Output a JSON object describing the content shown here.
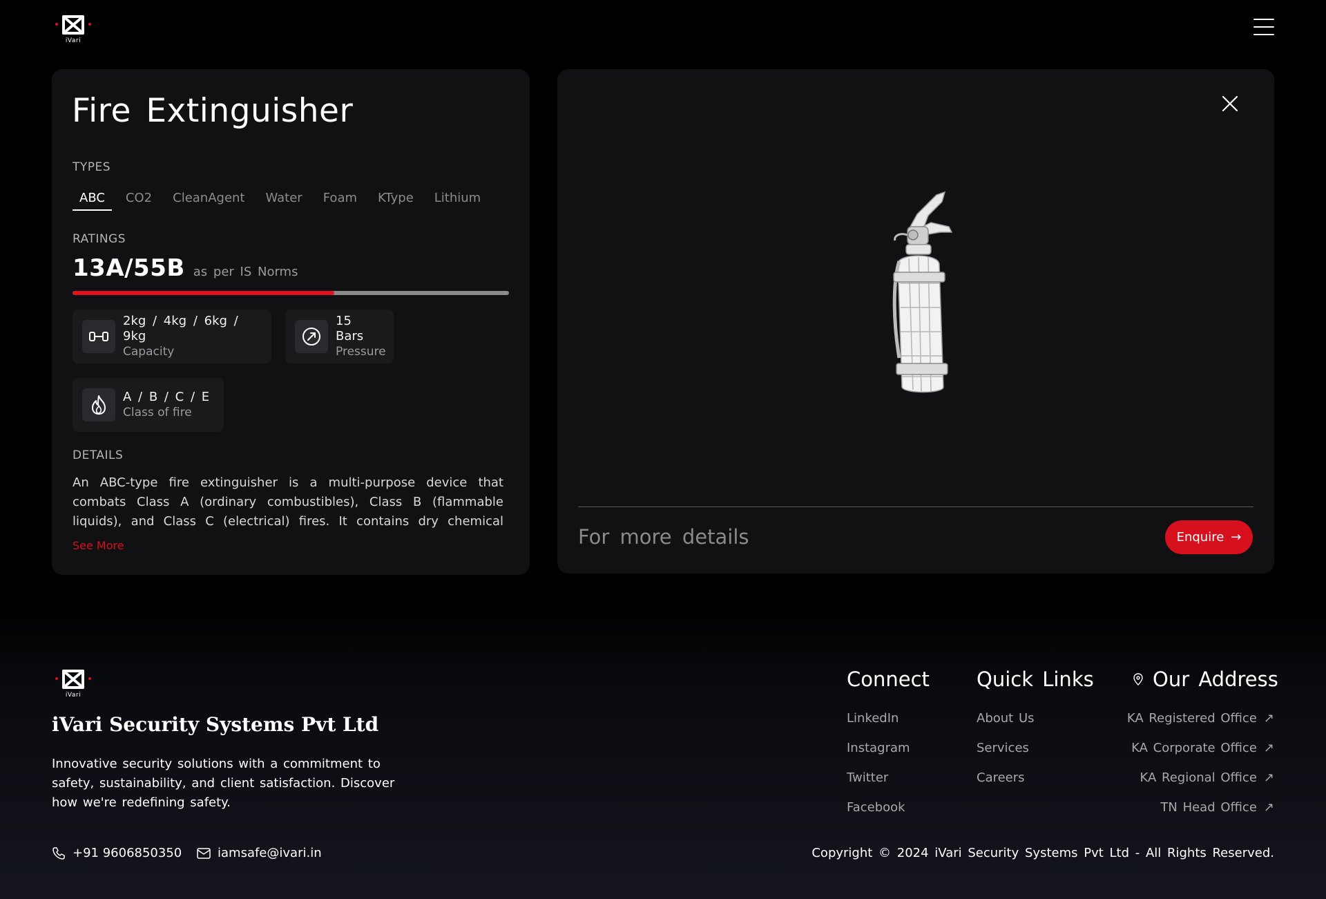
{
  "brand": {
    "logo_text": "iVari",
    "accent_color": "#d6101d"
  },
  "header": {
    "menu_icon": "hamburger-menu-icon"
  },
  "product": {
    "title": "Fire Extinguisher",
    "types_label": "TYPES",
    "types": [
      {
        "label": "ABC",
        "active": true
      },
      {
        "label": "CO2",
        "active": false
      },
      {
        "label": "CleanAgent",
        "active": false
      },
      {
        "label": "Water",
        "active": false
      },
      {
        "label": "Foam",
        "active": false
      },
      {
        "label": "KType",
        "active": false
      },
      {
        "label": "Lithium",
        "active": false
      }
    ],
    "ratings_label": "RATINGS",
    "rating_value": "13A/55B",
    "rating_note": "as per IS Norms",
    "rating_level_percent": 60,
    "specs": {
      "capacity": {
        "value": "2kg / 4kg / 6kg / 9kg",
        "caption": "Capacity",
        "icon": "weight-range-icon"
      },
      "pressure": {
        "value": "15 Bars",
        "caption": "Pressure",
        "icon": "pressure-gauge-icon"
      },
      "fire_class": {
        "value": "A / B / C / E",
        "caption": "Class of fire",
        "icon": "flame-icon"
      }
    },
    "details_label": "DETAILS",
    "details_text": "An ABC-type fire extinguisher is a multi-purpose device that combats Class A (ordinary combustibles), Class B (flammable liquids), and Class C (electrical) fires. It contains dry chemical powder that suppresses...",
    "see_more": "See More"
  },
  "viewer": {
    "close_icon": "close-icon",
    "more_details": "For more details",
    "enquire_label": "Enquire",
    "enquire_arrow": "→"
  },
  "footer": {
    "company_name": "iVari Security Systems Pvt Ltd",
    "company_desc": "Innovative security solutions with a commitment to safety, sustainability, and client satisfaction. Discover how we're redefining safety.",
    "phone": "+91 9606850350",
    "email": "iamsafe@ivari.in",
    "connect_title": "Connect",
    "connect_links": [
      "LinkedIn",
      "Instagram",
      "Twitter",
      "Facebook"
    ],
    "quick_title": "Quick Links",
    "quick_links": [
      "About Us",
      "Services",
      "Careers"
    ],
    "address_title": "Our Address",
    "address_links": [
      "KA Registered Office",
      "KA Corporate Office",
      "KA Regional Office",
      "TN Head Office"
    ],
    "external_arrow": "↗",
    "copyright": "Copyright © 2024 iVari Security Systems Pvt Ltd - All Rights Reserved."
  }
}
